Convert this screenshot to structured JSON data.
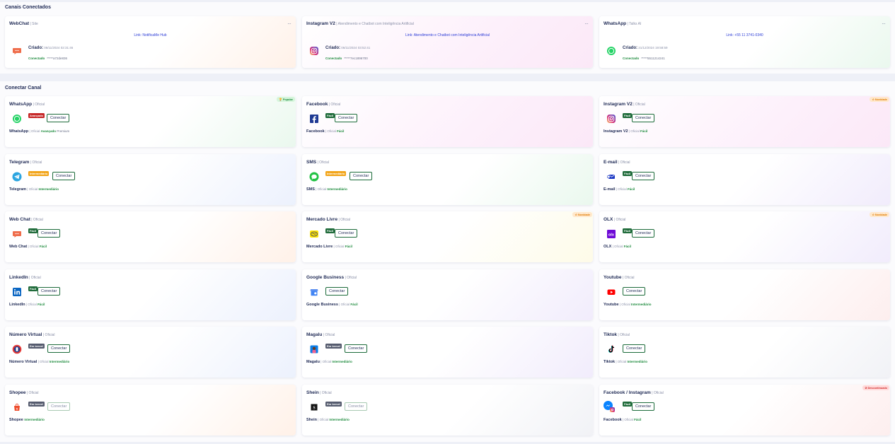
{
  "connected": {
    "title": "Canais Conectados",
    "cards": [
      {
        "name": "WebChat",
        "sub": "| Site",
        "link": "Link: NotificaMe Hub",
        "created_label": "Criado:",
        "created_val": "08/11/2024 02:31:46",
        "status": "Conectado",
        "token": "*****a72de836",
        "icon": "webchat-icon",
        "bg": "bg-orange"
      },
      {
        "name": "Instagram V2",
        "sub": "| Atendimento e Chatbot com Inteligência Artificial",
        "link": "Link: Atendimento e Chatbot com Inteligência Artificial",
        "created_label": "Criado:",
        "created_val": "06/11/2024 03:52:41",
        "status": "Conectado",
        "token": "*****7ec1896700",
        "icon": "instagram-icon",
        "bg": "bg-pink"
      },
      {
        "name": "WhatsApp",
        "sub": "| Talks AI",
        "link": "Link: +55 11 3741-0340",
        "created_label": "Criado:",
        "created_val": "21/12/2024 19:58:59",
        "status": "Conectado",
        "token": "*****5511214241",
        "icon": "whatsapp-icon",
        "bg": "bg-green"
      }
    ]
  },
  "connect": {
    "title": "Conectar Canal",
    "button_label": "Conectar",
    "menu": "···",
    "cards": [
      {
        "name": "WhatsApp",
        "official": "| Oficial",
        "level": "Avançado",
        "level_color": "#c62828",
        "footer_level": "Avançado",
        "footer_extra": "Premium",
        "icon": "whatsapp-icon",
        "bg": "bg-green",
        "badge": "🏆 Popular",
        "badge_kind": "popular"
      },
      {
        "name": "Facebook",
        "official": "| Oficial",
        "level": "Fácil",
        "level_color": "#1f6b3a",
        "footer_level": "Fácil",
        "icon": "facebook-icon",
        "bg": "bg-pink"
      },
      {
        "name": "Instagram V2",
        "official": "| Oficial",
        "level": "Fácil",
        "level_color": "#1f6b3a",
        "footer_level": "Fácil",
        "icon": "instagram-icon",
        "bg": "bg-pink",
        "badge": "☆ Novidade",
        "badge_kind": "new"
      },
      {
        "name": "Telegram",
        "official": "| Oficial",
        "level": "Intermediário",
        "level_color": "#f2a51a",
        "footer_level": "Intermediário",
        "icon": "telegram-icon",
        "bg": "bg-blue"
      },
      {
        "name": "SMS",
        "official": "| Oficial",
        "level": "Intermediário",
        "level_color": "#f2a51a",
        "footer_level": "Intermediário",
        "icon": "sms-icon",
        "bg": "bg-green"
      },
      {
        "name": "E-mail",
        "official": "| Oficial",
        "level": "Fácil",
        "level_color": "#1f6b3a",
        "footer_level": "Fácil",
        "icon": "email-icon",
        "bg": "bg-purple"
      },
      {
        "name": "Web Chat",
        "official": "| Oficial",
        "level": "Fácil",
        "level_color": "#1f6b3a",
        "footer_level": "Fácil",
        "icon": "webchat-icon",
        "bg": "bg-orange"
      },
      {
        "name": "Mercado Livre",
        "official": "| Oficial",
        "level": "Fácil",
        "level_color": "#1f6b3a",
        "footer_level": "Fácil",
        "icon": "mercadolivre-icon",
        "bg": "bg-yellow",
        "badge": "☆ Novidade",
        "badge_kind": "new"
      },
      {
        "name": "OLX",
        "official": "| Oficial",
        "level": "Fácil",
        "level_color": "#1f6b3a",
        "footer_level": "Fácil",
        "icon": "olx-icon",
        "bg": "bg-purple",
        "badge": "☆ Novidade",
        "badge_kind": "new"
      },
      {
        "name": "LinkedIn",
        "official": "| Oficial",
        "level": "Fácil",
        "level_color": "#1f6b3a",
        "footer_level": "Fácil",
        "icon": "linkedin-icon",
        "bg": "bg-blue"
      },
      {
        "name": "Google Business",
        "official": "| Oficial",
        "level": "",
        "level_color": "",
        "footer_level": "Fácil",
        "icon": "google-business-icon",
        "bg": "bg-purple"
      },
      {
        "name": "Youtube",
        "official": "| Oficial",
        "level": "",
        "level_color": "",
        "footer_level": "Intermediário",
        "icon": "youtube-icon",
        "bg": "bg-red"
      },
      {
        "name": "Número Virtual",
        "official": "| Oficial",
        "level": "Em breve!",
        "level_color": "#555b6e",
        "footer_level": "Intermediário",
        "icon": "virtual-number-icon",
        "bg": "bg-blue"
      },
      {
        "name": "Magalu",
        "official": "| Oficial",
        "level": "Em breve!",
        "level_color": "#555b6e",
        "footer_level": "Intermediário",
        "icon": "magalu-icon",
        "bg": "bg-purple"
      },
      {
        "name": "Tiktok",
        "official": "| Oficial",
        "level": "",
        "level_color": "",
        "footer_level": "Intermediário",
        "icon": "tiktok-icon",
        "bg": "bg-gray"
      },
      {
        "name": "Shopee",
        "official": "| Oficial",
        "level": "Em breve!",
        "level_color": "#555b6e",
        "footer_level": "Intermediário",
        "footer_no_official": true,
        "icon": "shopee-icon",
        "bg": "bg-orange",
        "disabled": true
      },
      {
        "name": "Shein",
        "official": "| Oficial",
        "level": "Em breve!",
        "level_color": "#555b6e",
        "footer_level": "Intermediário",
        "icon": "shein-icon",
        "bg": "bg-gray",
        "disabled": true
      },
      {
        "name": "Facebook / Instagram",
        "official": "| Oficial",
        "level": "Fácil",
        "level_color": "#1f6b3a",
        "footer_level": "Fácil",
        "footer_name": "Facebook",
        "icon": "messenger-instagram-icon",
        "bg": "bg-red",
        "badge": "⊘ Descontinuado",
        "badge_kind": "discontinued"
      }
    ]
  }
}
